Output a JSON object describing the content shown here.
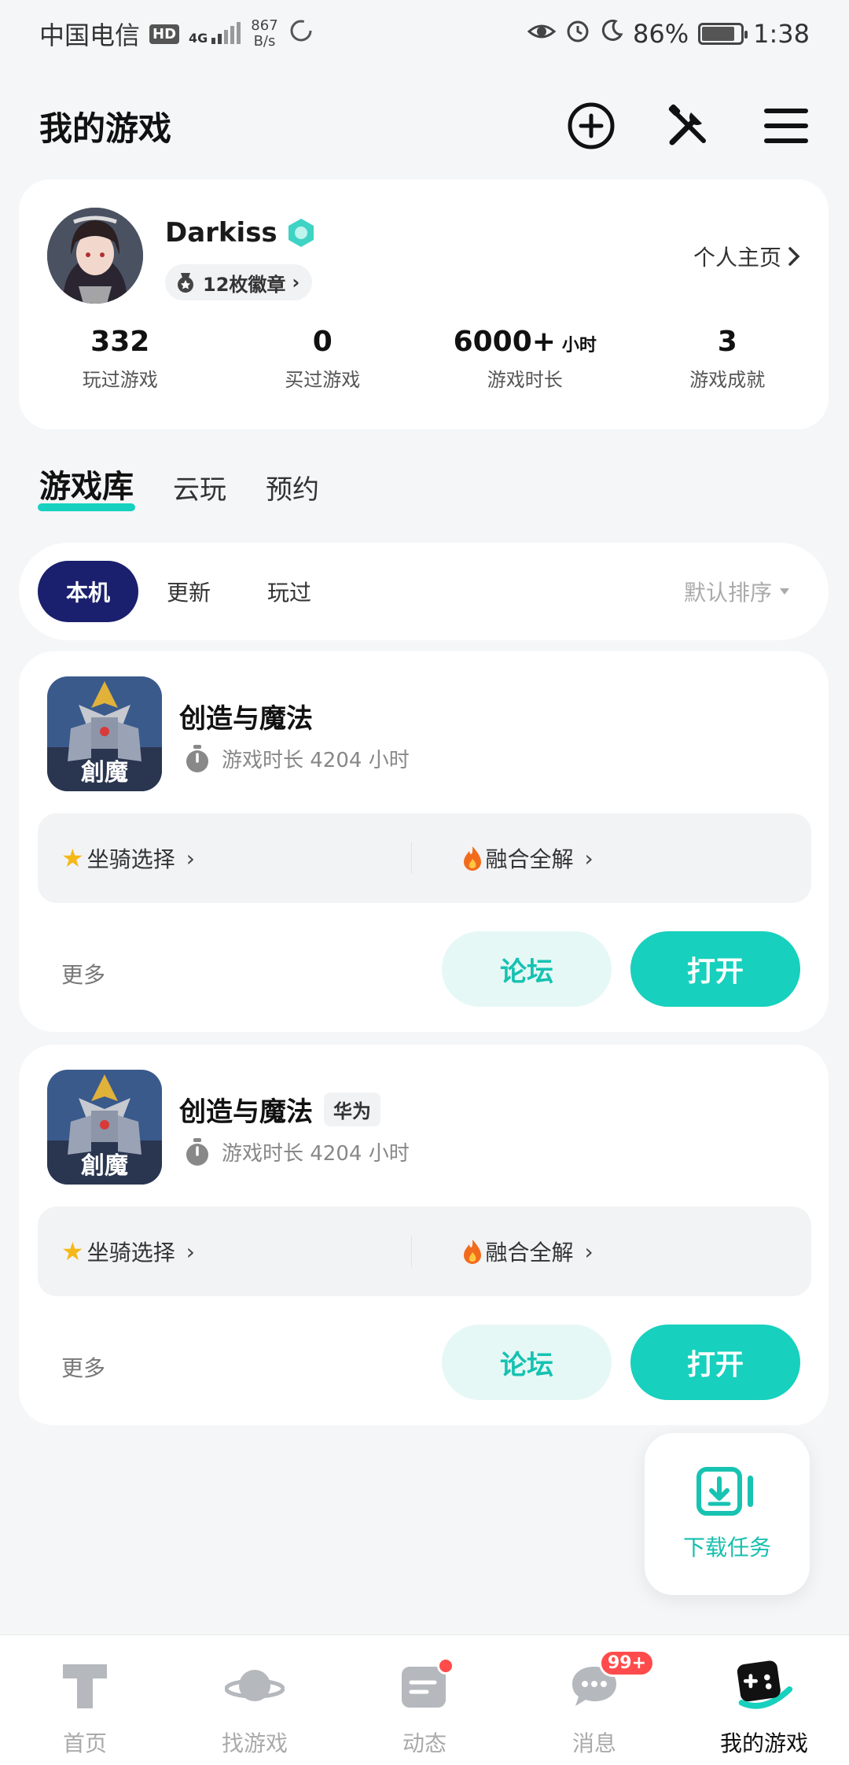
{
  "status_bar": {
    "carrier": "中国电信",
    "hd": "HD",
    "signal": "4G",
    "speed_value": "867",
    "speed_unit": "B/s",
    "battery": "86%",
    "battery_level": 0.86,
    "time": "1:38"
  },
  "header": {
    "title": "我的游戏",
    "icons": [
      "add-circle-icon",
      "tools-icon",
      "menu-icon"
    ]
  },
  "profile": {
    "username": "Darkiss",
    "badges": "12枚徽章",
    "home_link": "个人主页",
    "stats": [
      {
        "value": "332",
        "unit": "",
        "label": "玩过游戏"
      },
      {
        "value": "0",
        "unit": "",
        "label": "买过游戏"
      },
      {
        "value": "6000+",
        "unit": "小时",
        "label": "游戏时长"
      },
      {
        "value": "3",
        "unit": "",
        "label": "游戏成就"
      }
    ]
  },
  "tabs": [
    {
      "label": "游戏库",
      "active": true
    },
    {
      "label": "云玩",
      "active": false
    },
    {
      "label": "预约",
      "active": false
    }
  ],
  "filters": {
    "items": [
      {
        "label": "本机",
        "active": true
      },
      {
        "label": "更新",
        "active": false
      },
      {
        "label": "玩过",
        "active": false
      }
    ],
    "sort": "默认排序"
  },
  "games": [
    {
      "name": "创造与魔法",
      "tag": "",
      "play_time": "游戏时长 4204 小时",
      "link1": "坐骑选择",
      "link2": "融合全解",
      "more": "更多",
      "forum": "论坛",
      "open": "打开"
    },
    {
      "name": "创造与魔法",
      "tag": "华为",
      "play_time": "游戏时长 4204 小时",
      "link1": "坐骑选择",
      "link2": "融合全解",
      "more": "更多",
      "forum": "论坛",
      "open": "打开"
    }
  ],
  "download_task": "下载任务",
  "bottom_nav": [
    {
      "label": "首页",
      "icon": "home-icon"
    },
    {
      "label": "找游戏",
      "icon": "planet-icon"
    },
    {
      "label": "动态",
      "icon": "feed-icon"
    },
    {
      "label": "消息",
      "icon": "message-icon",
      "badge": "99+"
    },
    {
      "label": "我的游戏",
      "icon": "gamepad-icon"
    }
  ],
  "colors": {
    "accent": "#17d0bd",
    "filter_active": "#1a1f6e",
    "badge_red": "#ff4b4b"
  }
}
